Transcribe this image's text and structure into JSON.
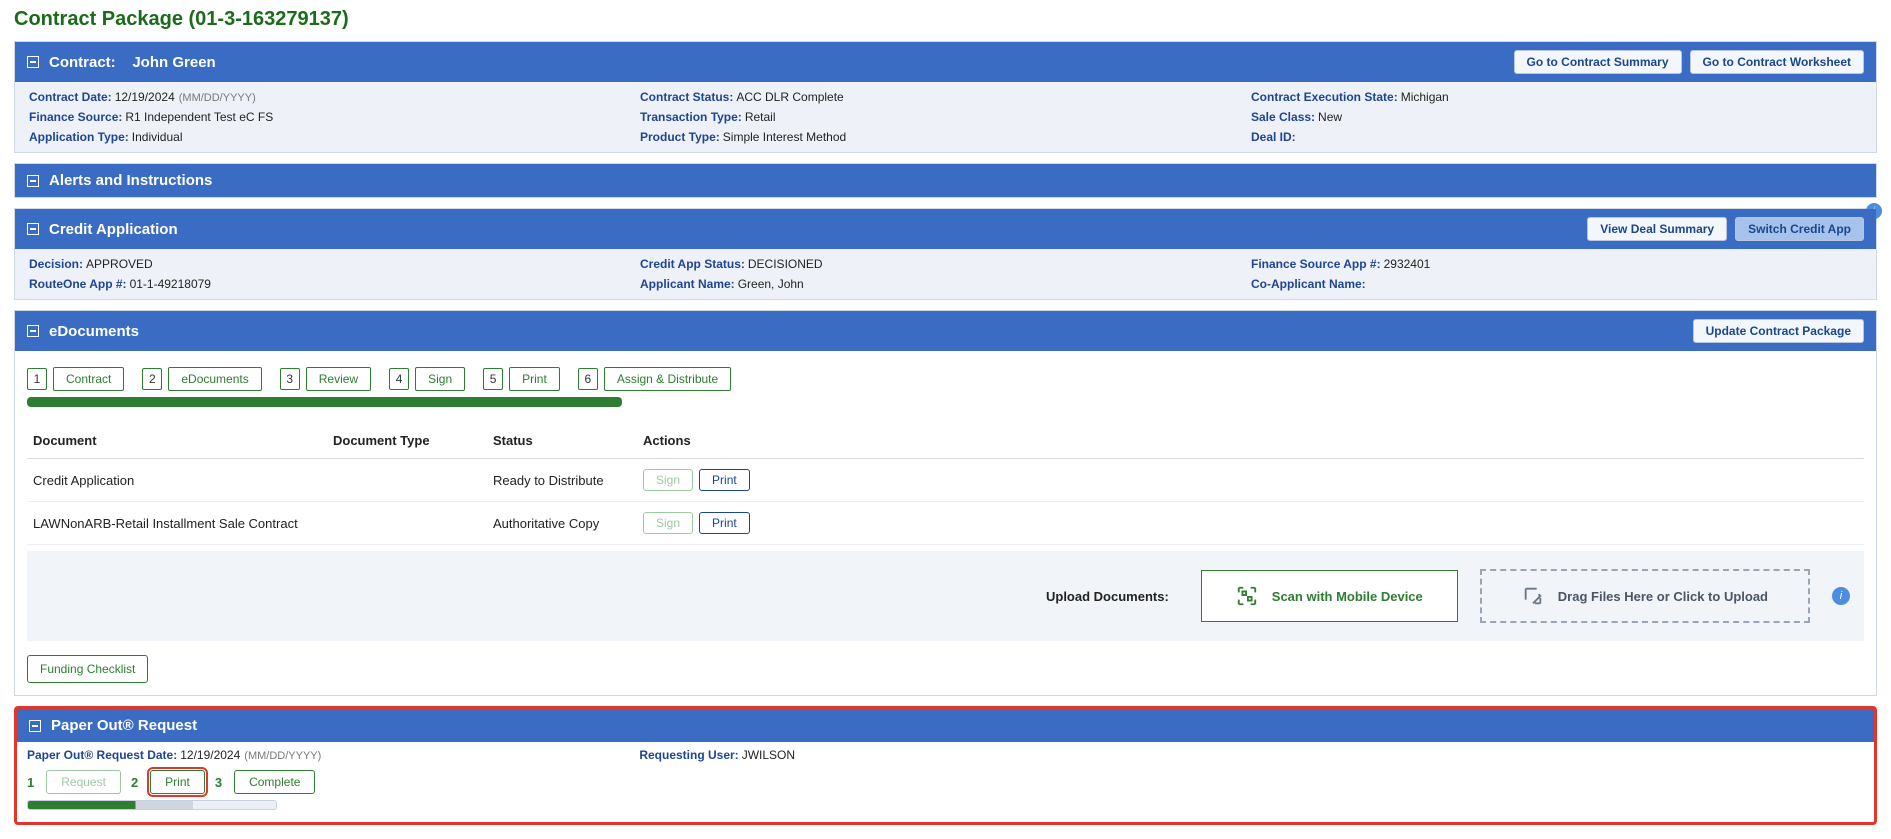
{
  "page_title": "Contract Package (01-3-163279137)",
  "contract_panel": {
    "title_prefix": "Contract:",
    "title_name": "John Green",
    "btn_summary": "Go to Contract Summary",
    "btn_worksheet": "Go to Contract Worksheet",
    "col1": {
      "date_lbl": "Contract Date:",
      "date_val": "12/19/2024",
      "date_hint": "(MM/DD/YYYY)",
      "fs_lbl": "Finance Source:",
      "fs_val": "R1 Independent Test eC FS",
      "apptype_lbl": "Application Type:",
      "apptype_val": "Individual"
    },
    "col2": {
      "status_lbl": "Contract Status:",
      "status_val": "ACC DLR Complete",
      "txtype_lbl": "Transaction Type:",
      "txtype_val": "Retail",
      "ptype_lbl": "Product Type:",
      "ptype_val": "Simple Interest Method"
    },
    "col3": {
      "exec_lbl": "Contract Execution State:",
      "exec_val": "Michigan",
      "sclass_lbl": "Sale Class:",
      "sclass_val": "New",
      "deal_lbl": "Deal ID:",
      "deal_val": ""
    }
  },
  "alerts_panel": {
    "title": "Alerts and Instructions"
  },
  "credit_panel": {
    "title": "Credit Application",
    "btn_view": "View Deal Summary",
    "btn_switch": "Switch Credit App",
    "col1": {
      "decision_lbl": "Decision:",
      "decision_val": "APPROVED",
      "r1app_lbl": "RouteOne App #:",
      "r1app_val": "01-1-49218079"
    },
    "col2": {
      "castat_lbl": "Credit App Status:",
      "castat_val": "DECISIONED",
      "appname_lbl": "Applicant Name:",
      "appname_val": "Green, John"
    },
    "col3": {
      "fsapp_lbl": "Finance Source App #:",
      "fsapp_val": "2932401",
      "coapp_lbl": "Co-Applicant Name:",
      "coapp_val": ""
    }
  },
  "edoc_panel": {
    "title": "eDocuments",
    "btn_update": "Update Contract Package",
    "steps": [
      {
        "n": "1",
        "label": "Contract"
      },
      {
        "n": "2",
        "label": "eDocuments"
      },
      {
        "n": "3",
        "label": "Review"
      },
      {
        "n": "4",
        "label": "Sign"
      },
      {
        "n": "5",
        "label": "Print"
      },
      {
        "n": "6",
        "label": "Assign & Distribute"
      }
    ],
    "columns": {
      "c1": "Document",
      "c2": "Document Type",
      "c3": "Status",
      "c4": "Actions"
    },
    "rows": [
      {
        "doc": "Credit Application",
        "type": "",
        "status": "Ready to Distribute"
      },
      {
        "doc": "LAWNonARB-Retail Installment Sale Contract",
        "type": "",
        "status": "Authoritative Copy"
      }
    ],
    "action_sign": "Sign",
    "action_print": "Print",
    "upload_lbl": "Upload Documents:",
    "scan_btn": "Scan with Mobile Device",
    "drop_btn": "Drag Files Here or  Click to Upload",
    "funding_btn": "Funding Checklist"
  },
  "paperout_panel": {
    "title": "Paper Out® Request",
    "date_lbl": "Paper Out® Request Date:",
    "date_val": "12/19/2024",
    "date_hint": "(MM/DD/YYYY)",
    "user_lbl": "Requesting User:",
    "user_val": "JWILSON",
    "steps": [
      {
        "n": "1",
        "label": "Request"
      },
      {
        "n": "2",
        "label": "Print"
      },
      {
        "n": "3",
        "label": "Complete"
      }
    ]
  }
}
